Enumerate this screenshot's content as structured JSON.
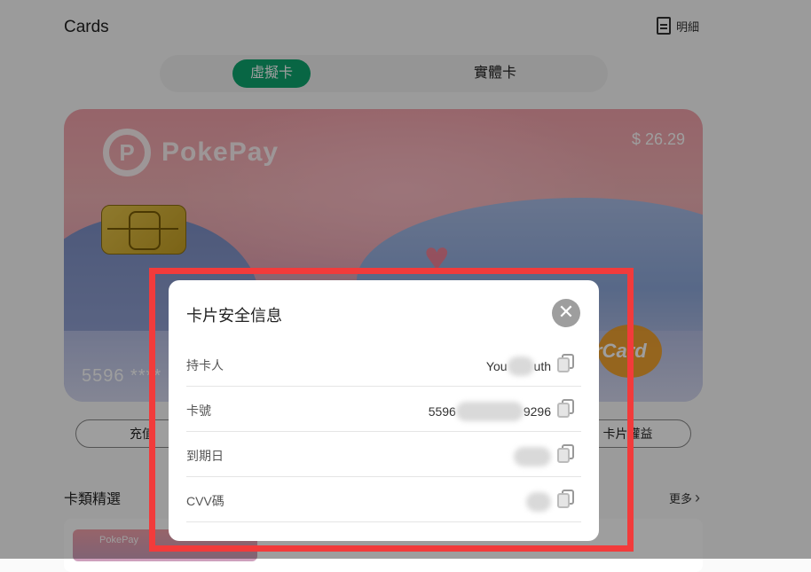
{
  "header": {
    "title": "Cards",
    "detail_label": "明細",
    "detail_icon": "document-icon"
  },
  "tabs": {
    "virtual": "虛擬卡",
    "physical": "實體卡",
    "active": "虛擬卡"
  },
  "card": {
    "brand": "PokePay",
    "balance": "$ 26.29",
    "number_masked": "5596 ****",
    "network": "rCard"
  },
  "actions": {
    "left_label": "充值",
    "right_label": "卡片權益"
  },
  "featured": {
    "title": "卡類精選",
    "more_label": "更多",
    "thumb_brand": "PokePay"
  },
  "modal": {
    "title": "卡片安全信息",
    "close_icon": "close-icon",
    "rows": [
      {
        "label": "持卡人",
        "value_prefix": "You",
        "value_suffix": "uth"
      },
      {
        "label": "卡號",
        "value_prefix": "5596",
        "value_suffix": "9296"
      },
      {
        "label": "到期日",
        "value_prefix": "",
        "value_suffix": ""
      },
      {
        "label": "CVV碼",
        "value_prefix": "",
        "value_suffix": ""
      }
    ]
  },
  "colors": {
    "accent": "#0ea56f",
    "highlight": "#f23b3b",
    "close_bg": "#9e9e9e"
  }
}
